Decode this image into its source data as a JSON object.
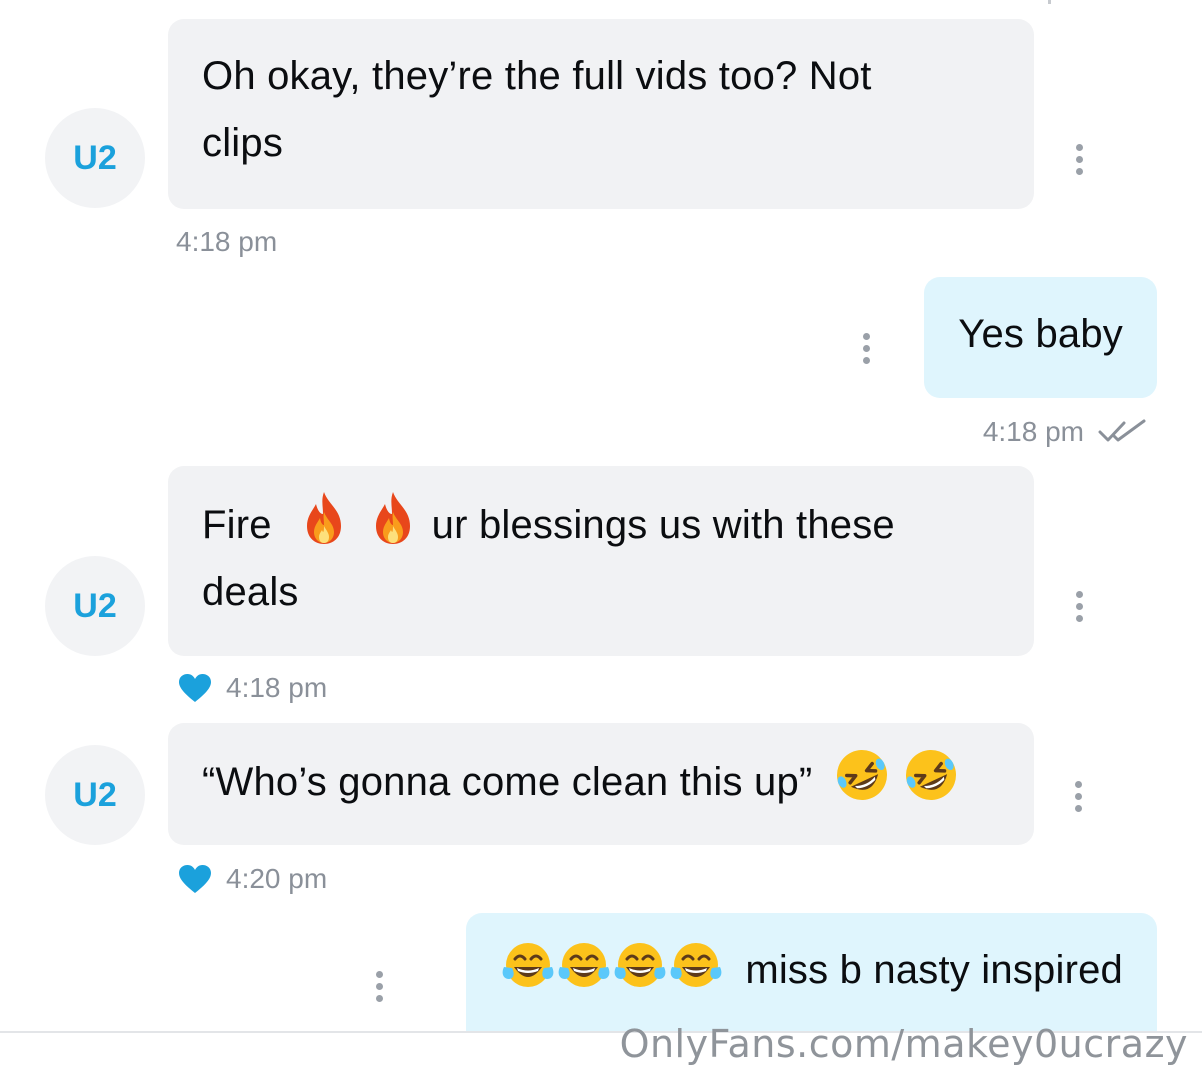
{
  "messages": [
    {
      "direction": "incoming",
      "avatar_initials": "U2",
      "text_line1": "Oh okay, they’re the full vids too? Not",
      "text_line2": "clips",
      "time": "4:18 pm"
    },
    {
      "direction": "outgoing",
      "text": "Yes baby",
      "time": "4:18 pm",
      "read_status": "double-check"
    },
    {
      "direction": "incoming",
      "avatar_initials": "U2",
      "text_prefix": "Fire",
      "emojis": [
        "fire-icon",
        "fire-icon"
      ],
      "text_suffix": "ur blessings us with these",
      "text_line2": "deals",
      "time": "4:18 pm",
      "liked": true
    },
    {
      "direction": "incoming",
      "avatar_initials": "U2",
      "text": "“Who’s gonna come clean this up”",
      "emojis": [
        "rofl-icon",
        "rofl-icon"
      ],
      "time": "4:20 pm",
      "liked": true
    },
    {
      "direction": "outgoing",
      "emojis": [
        "tears-of-joy-icon",
        "tears-of-joy-icon",
        "tears-of-joy-icon",
        "tears-of-joy-icon"
      ],
      "text": "miss b nasty inspired"
    }
  ],
  "colors": {
    "accent": "#1ba1dc",
    "incoming_bubble": "#f1f2f4",
    "outgoing_bubble": "#dff5fd",
    "timestamp": "#8a9099"
  },
  "watermark": "OnlyFans.com/makey0ucrazy"
}
